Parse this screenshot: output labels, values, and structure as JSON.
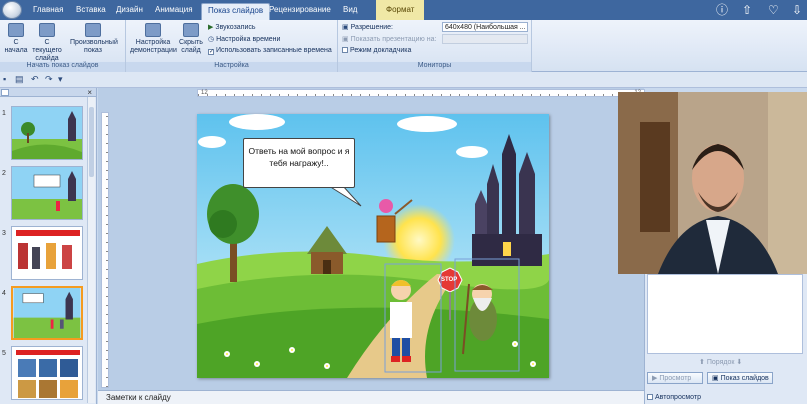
{
  "tabs": [
    "Главная",
    "Вставка",
    "Дизайн",
    "Анимация",
    "Показ слайдов",
    "Рецензирование",
    "Вид",
    "Формат"
  ],
  "active_tab": "Показ слайдов",
  "ribbon": {
    "start_group": {
      "label": "Начать показ слайдов",
      "from_start": "С начала",
      "from_current": "С текущего слайда",
      "custom_show": "Произвольный показ"
    },
    "setup_group": {
      "label": "Настройка",
      "setup_show": "Настройка демонстрации",
      "hide_slide": "Скрыть слайд",
      "record_narration": "Звукозапись",
      "rehearse_timings": "Настройка времени",
      "use_timings": "Использовать записанные времена"
    },
    "monitors_group": {
      "label": "Мониторы",
      "resolution_label": "Разрешение:",
      "resolution_value": "640x480 (Наибольшая ...",
      "show_on_label": "Показать презентацию на:",
      "presenter_view": "Режим докладчика"
    }
  },
  "top_icons": [
    "info-icon",
    "share-icon",
    "heart-icon",
    "download-icon"
  ],
  "thumbnails": [
    {
      "num": "1"
    },
    {
      "num": "2"
    },
    {
      "num": "3"
    },
    {
      "num": "4"
    },
    {
      "num": "5"
    }
  ],
  "ruler": {
    "left": "12",
    "right": "12"
  },
  "slide": {
    "speech_bubble": "Ответь на мой вопрос и я тебя награжу!..",
    "stop_sign": "STOP"
  },
  "notes_placeholder": "Заметки к слайду",
  "right_panel": {
    "order_label": "Порядок",
    "preview_button": "Просмотр",
    "slideshow_button": "Показ слайдов",
    "autopreview": "Автопросмотр"
  },
  "colors": {
    "tab_bar": "#3e679f",
    "format_tab": "#f0e8a6",
    "selected_thumb": "#f59b1f"
  }
}
